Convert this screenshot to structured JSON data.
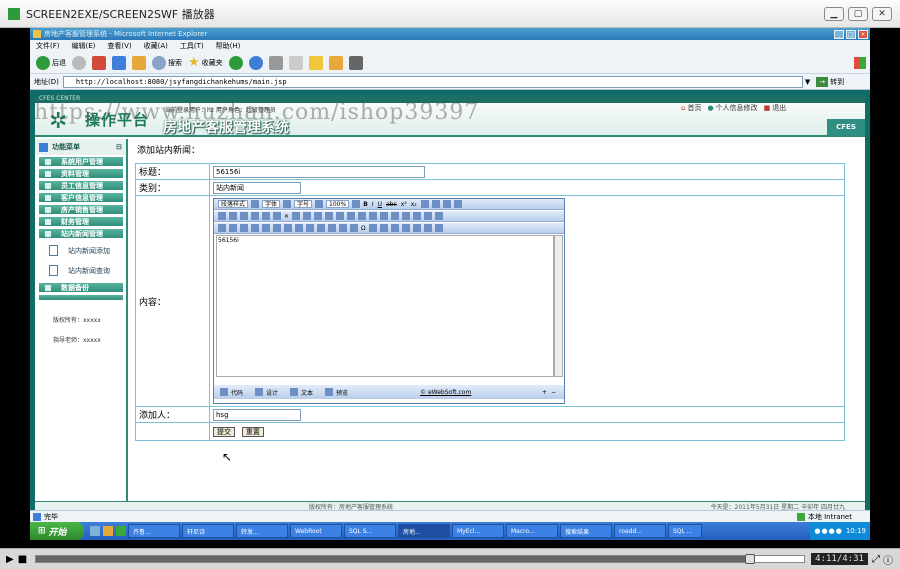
{
  "player": {
    "title": "SCREEN2EXE/SCREEN2SWF 播放器",
    "time": "4:11/4:31",
    "progress_fraction": 0.93
  },
  "browser": {
    "title": "房地产客服管理系统 - Microsoft Internet Explorer",
    "menu": [
      "文件(F)",
      "编辑(E)",
      "查看(V)",
      "收藏(A)",
      "工具(T)",
      "帮助(H)"
    ],
    "toolbar": {
      "back": "后退",
      "search": "搜索",
      "favorites": "收藏夹"
    },
    "address_label": "地址(D)",
    "url": "http://localhost:8080/jsyfangdichankehums/main.jsp",
    "go": "转到",
    "status_left": "完毕",
    "status_right": "本地 Intranet"
  },
  "app": {
    "topbar": "CFES CENTER",
    "logo_text": "操作平台",
    "system_title": "房地产客服管理系统",
    "user_info": "当前登录用户：hz  用户角色：超级管理员",
    "top_links": [
      "首页",
      "个人信息修改",
      "退出"
    ],
    "badge": "CFES",
    "sidebar": {
      "header": "功能菜单",
      "items": [
        "系统用户管理",
        "资料管理",
        "员工信息管理",
        "客户信息管理",
        "房产销售管理",
        "财务管理",
        "站内新闻管理"
      ],
      "subitems": [
        "站内新闻添加",
        "站内新闻查询"
      ],
      "after_item": "数据备份",
      "copyright": "版权所有：xxxxx",
      "advisor": "指导老师：xxxxx"
    },
    "content": {
      "page_title": "添加站内新闻：",
      "fields": {
        "title_label": "标题：",
        "title_value": "56156i",
        "category_label": "类别：",
        "category_value": "站内新闻",
        "content_label": "内容：",
        "content_value": "56156i",
        "adder_label": "添加人：",
        "adder_value": "hsg"
      },
      "editor": {
        "style_select": "段落样式",
        "font_select": "字体",
        "size_select": "字号",
        "zoom": "100%",
        "tabs": [
          "代码",
          "设计",
          "文本",
          "预览"
        ],
        "credit": "© eWebSoft.com"
      },
      "buttons": {
        "submit": "提交",
        "reset": "重置"
      }
    },
    "footer_left": "版权所有：房地产客服管理系统",
    "footer_right": "今天是：2011年5月31日 星期二 辛卯年 四月廿九"
  },
  "taskbar": {
    "start": "开始",
    "tasks": [
      "齐鲁...",
      "轩尼诗",
      "转发...",
      "WebRoot",
      "SQL S...",
      "房地...",
      "MyEcl...",
      "Macro...",
      "搜索结果",
      "roadd...",
      "SQL ..."
    ],
    "clock": "10:19"
  },
  "watermark": "https://www.huzhan.com/ishop39397"
}
